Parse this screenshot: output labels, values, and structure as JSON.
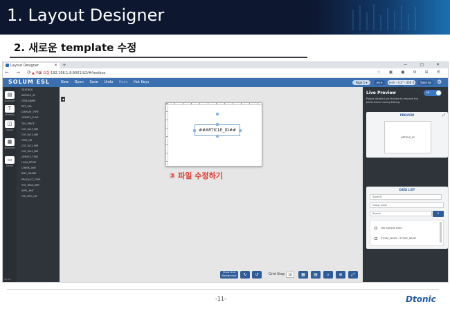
{
  "slide": {
    "title": "1. Layout Designer",
    "subtitle": "2. 새로운 template 수정",
    "annotation": "③ 파일 수정하기",
    "page_number": "-11-",
    "logo": "Dtonic"
  },
  "browser": {
    "tab_title": "Layout Designer",
    "new_tab": "+",
    "window_controls": "— □ ✕",
    "nav": "← → ⟳ ⌂",
    "url_warning": "▲ 주의 요함",
    "url": "192.168.1.8:9001/LD/#/textbox",
    "url_icons": "☆ ▣ ● ⚙ ⊞ ☰"
  },
  "app": {
    "brand": "SOLUM ESL",
    "menu": {
      "new": "New",
      "open": "Open",
      "save": "Save",
      "undo": "Undo",
      "redo": "Redo",
      "hotkeys": "Hot Keys"
    },
    "page_select": "Page 1 ▾",
    "lang_select": "en ▾",
    "size_select": "tech - 4.2\" - 400 X 300 ▾",
    "save_as": "Save As",
    "version": "v1.0.0"
  },
  "tools": [
    {
      "icon": "▤",
      "label": "BARCODE"
    },
    {
      "icon": "T",
      "label": "TEXTBOX"
    },
    {
      "icon": "◫",
      "label": "IMAGE"
    },
    {
      "icon": "▦",
      "label": "BARCODE"
    },
    {
      "icon": "▭",
      "label": "SHAPE"
    }
  ],
  "fields": [
    "TEXTBOX",
    "ARTICLE_ID",
    "ITEM_NAME",
    "RPT_URL",
    "DISPLAY_TYPE",
    "UPDATE_FLAG",
    "TAG_PRICE",
    "CAT_LVL3_NM",
    "CAT_LVL1_NM",
    "ITEM_CD",
    "CAT_LVL2_NM",
    "CAT_LVL4_NM",
    "UPDATE_TIME",
    "LOCA_PRICE",
    "CHKEK_AMT",
    "RMT_GRADE",
    "PRODUCT_TYPE",
    "TOT_RISK_AMT",
    "APPL_AMT",
    "HIS_ORG_CD"
  ],
  "canvas": {
    "textbox": "##ARTICLE_ID##"
  },
  "bottombar": {
    "measure": "Show Grid Background",
    "grid_step_label": "Grid Step",
    "grid_step_value": "10"
  },
  "right_panel": {
    "live_preview_title": "Live Preview",
    "toggle": "ON",
    "description": "Please disable Live Preview to improve the performance during Editing.",
    "preview_title": "PREVIEW",
    "preview_text": "ARTICLE_ID",
    "data_list_title": "DATA LIST",
    "store_select": "Store ID",
    "group_input": "Group Code",
    "search_placeholder": "Search",
    "list_items": [
      "Use Sample Data",
      "STORE_NAME : STORE_NAME"
    ]
  }
}
